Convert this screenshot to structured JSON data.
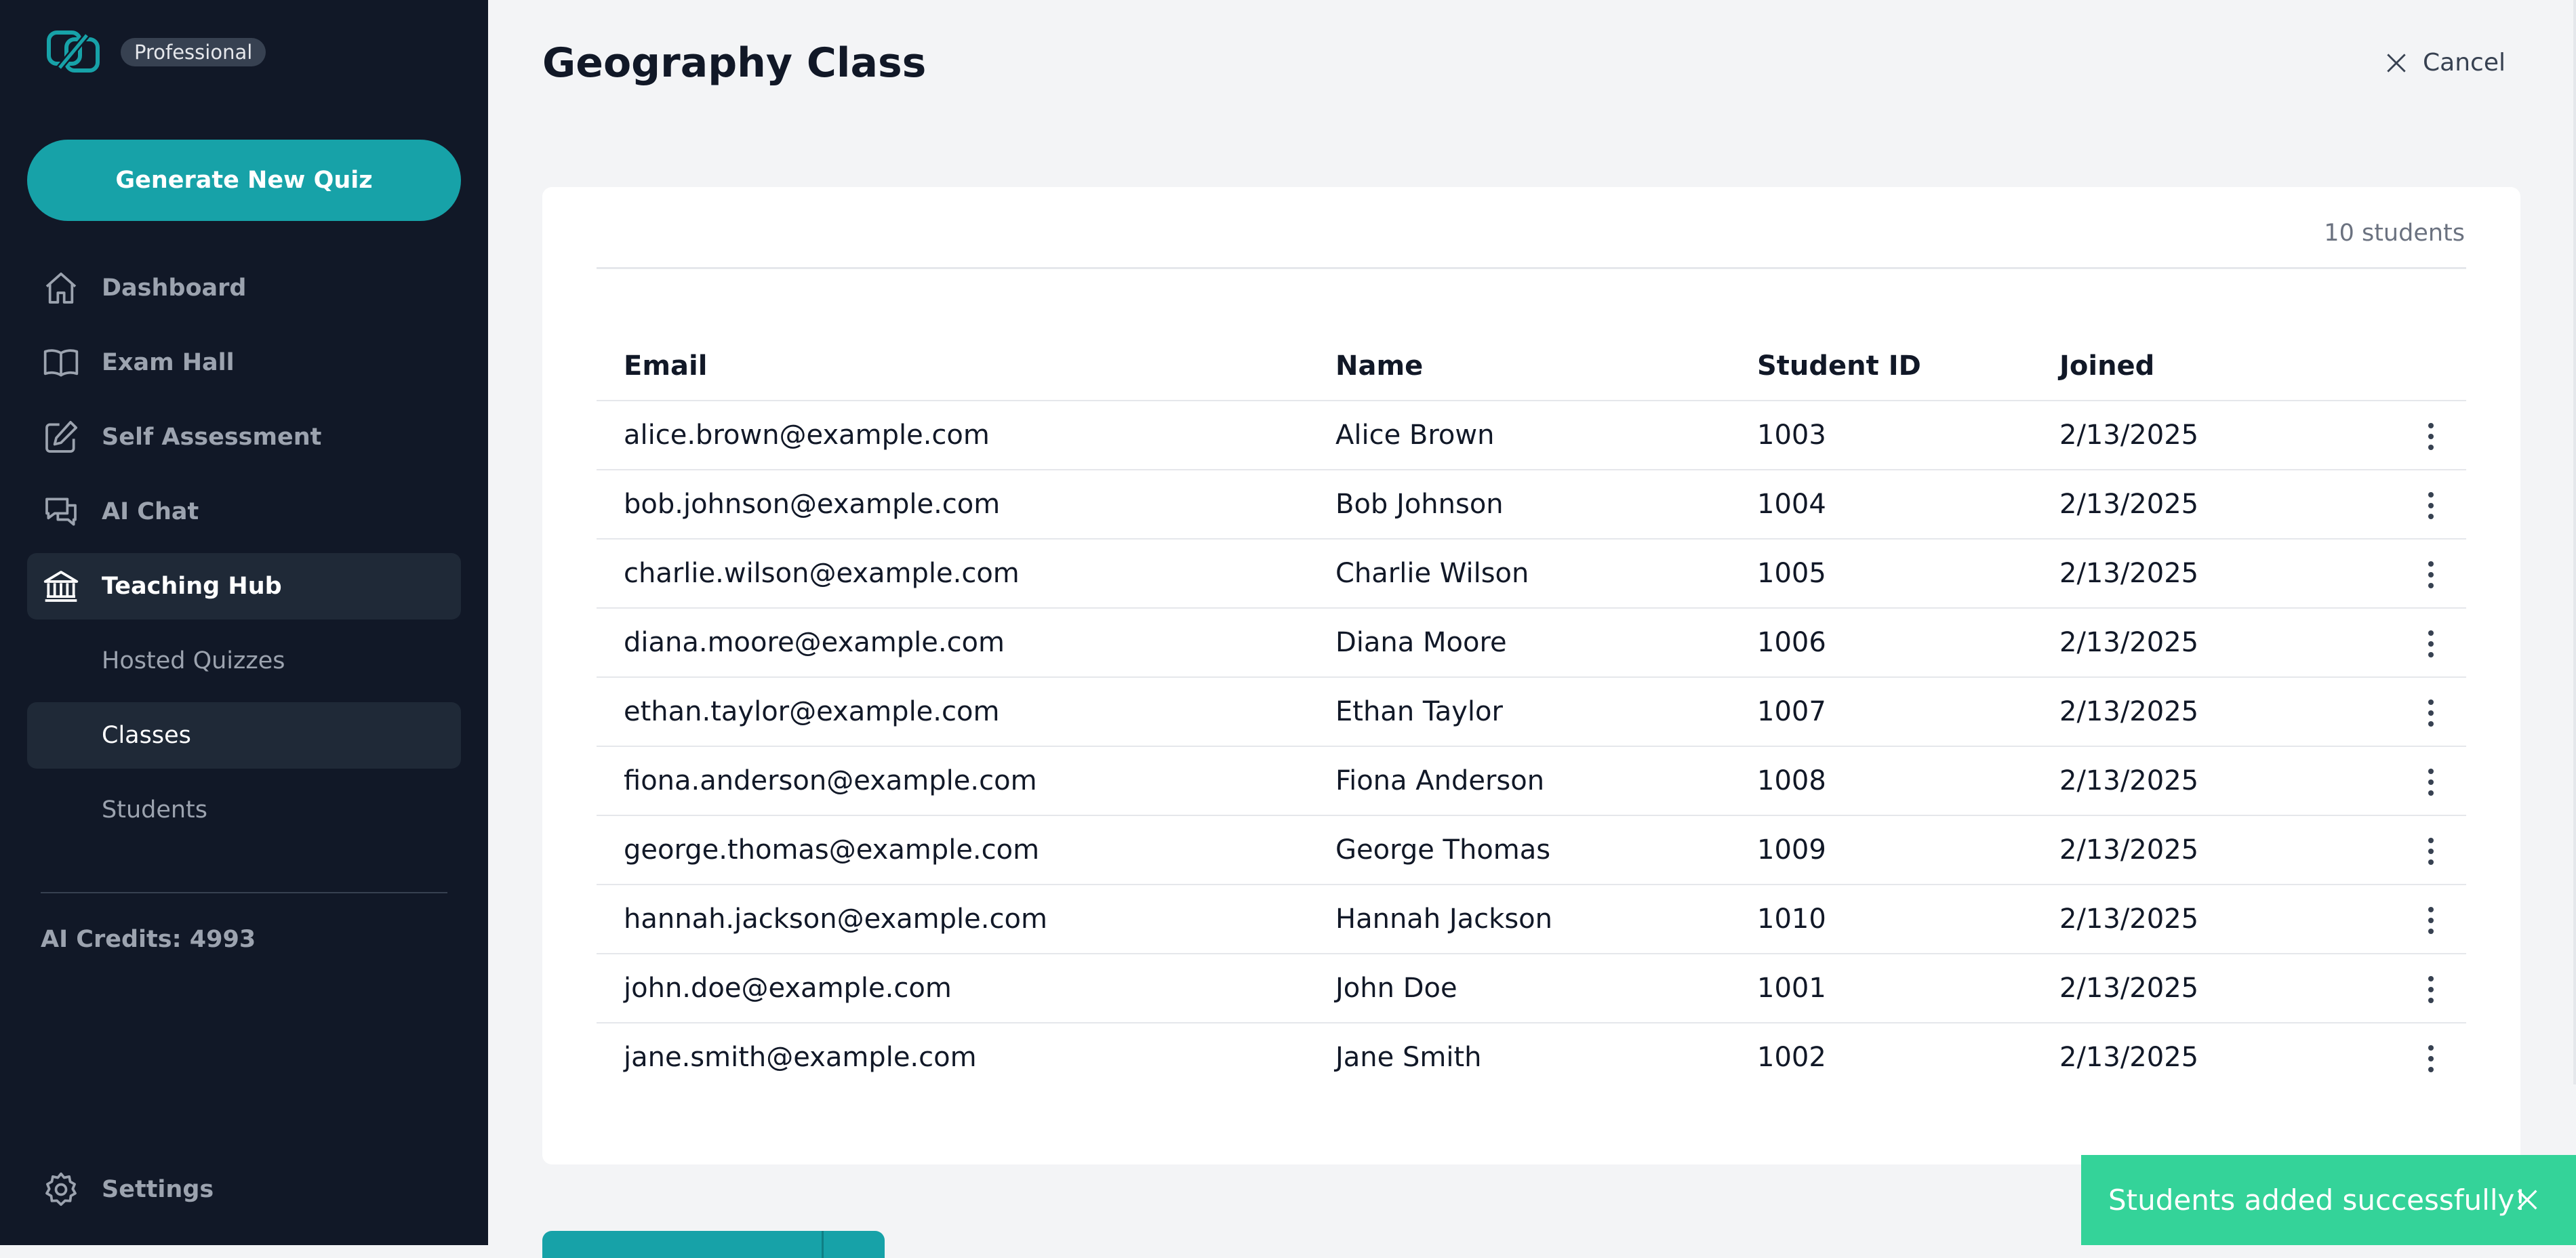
{
  "sidebar": {
    "plan_badge": "Professional",
    "generate_button": "Generate New Quiz",
    "nav": {
      "dashboard": "Dashboard",
      "exam_hall": "Exam Hall",
      "self_assessment": "Self Assessment",
      "ai_chat": "AI Chat",
      "teaching_hub": "Teaching Hub"
    },
    "sub": {
      "hosted_quizzes": "Hosted Quizzes",
      "classes": "Classes",
      "students": "Students"
    },
    "credits": "AI Credits: 4993",
    "settings": "Settings"
  },
  "header": {
    "title": "Geography Class",
    "cancel": "Cancel"
  },
  "card": {
    "student_count": "10 students"
  },
  "table": {
    "columns": [
      "Email",
      "Name",
      "Student ID",
      "Joined"
    ],
    "rows": [
      {
        "email": "alice.brown@example.com",
        "name": "Alice Brown",
        "id": "1003",
        "joined": "2/13/2025"
      },
      {
        "email": "bob.johnson@example.com",
        "name": "Bob Johnson",
        "id": "1004",
        "joined": "2/13/2025"
      },
      {
        "email": "charlie.wilson@example.com",
        "name": "Charlie Wilson",
        "id": "1005",
        "joined": "2/13/2025"
      },
      {
        "email": "diana.moore@example.com",
        "name": "Diana Moore",
        "id": "1006",
        "joined": "2/13/2025"
      },
      {
        "email": "ethan.taylor@example.com",
        "name": "Ethan Taylor",
        "id": "1007",
        "joined": "2/13/2025"
      },
      {
        "email": "fiona.anderson@example.com",
        "name": "Fiona Anderson",
        "id": "1008",
        "joined": "2/13/2025"
      },
      {
        "email": "george.thomas@example.com",
        "name": "George Thomas",
        "id": "1009",
        "joined": "2/13/2025"
      },
      {
        "email": "hannah.jackson@example.com",
        "name": "Hannah Jackson",
        "id": "1010",
        "joined": "2/13/2025"
      },
      {
        "email": "john.doe@example.com",
        "name": "John Doe",
        "id": "1001",
        "joined": "2/13/2025"
      },
      {
        "email": "jane.smith@example.com",
        "name": "Jane Smith",
        "id": "1002",
        "joined": "2/13/2025"
      }
    ]
  },
  "toast": {
    "message": "Students added successfully!"
  },
  "colors": {
    "sidebar_bg": "#111827",
    "accent": "#17a2a8",
    "toast_bg": "#34d399"
  }
}
